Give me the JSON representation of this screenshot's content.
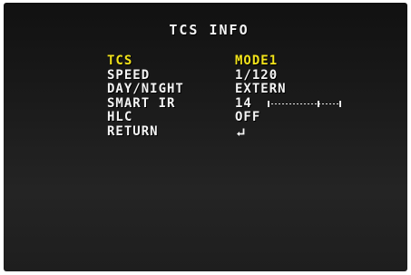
{
  "screen": {
    "title": "TCS INFO"
  },
  "menu": {
    "items": [
      {
        "label": "TCS",
        "value": "MODE1",
        "selected": true
      },
      {
        "label": "SPEED",
        "value": "1/120",
        "selected": false
      },
      {
        "label": "DAY/NIGHT",
        "value": "EXTERN",
        "selected": false
      },
      {
        "label": "SMART IR",
        "value": "14",
        "selected": false
      },
      {
        "label": "HLC",
        "value": "OFF",
        "selected": false
      },
      {
        "label": "RETURN",
        "value": "",
        "selected": false
      }
    ],
    "smart_ir_level_fraction": 0.7,
    "return_icon": "enter-return-icon"
  },
  "colors": {
    "background": "#1a1a1a",
    "text": "#f4f4f4",
    "selected": "#f2e31a"
  }
}
